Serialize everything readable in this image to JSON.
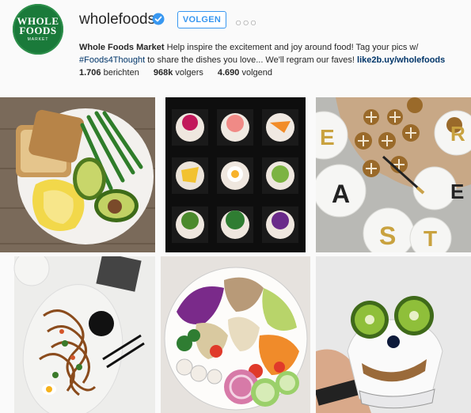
{
  "profile": {
    "avatar_line1": "WHOLE",
    "avatar_line2": "FOODS",
    "avatar_line3": "MARKET",
    "username": "wholefoods",
    "follow_label": "VOLGEN",
    "more_label": "○○○",
    "bio_name": "Whole Foods Market",
    "bio_text1": " Help inspire the excitement and joy around food! Tag your pics w/ ",
    "bio_hashtag": "#Foods4Thought",
    "bio_text2": " to share the dishes you love... We'll regram our faves! ",
    "bio_link": "like2b.uy/wholefoods",
    "stats": {
      "posts_count": "1.706",
      "posts_label": "berichten",
      "followers_count": "968k",
      "followers_label": "volgers",
      "following_count": "4.690",
      "following_label": "volgend"
    }
  },
  "posts": [
    {
      "name": "post-toast-avocado-eggs"
    },
    {
      "name": "post-rice-bowls-grid"
    },
    {
      "name": "post-easter-hot-cross-buns"
    },
    {
      "name": "post-noodle-platter"
    },
    {
      "name": "post-veggie-bowl"
    },
    {
      "name": "post-kiwi-yogurt-face"
    }
  ],
  "plate_letters": [
    "E",
    "R",
    "A",
    "S",
    "T",
    "E"
  ],
  "colors": {
    "accent": "#3897f0",
    "link": "#003569",
    "avatar_green": "#1a7a3a"
  }
}
